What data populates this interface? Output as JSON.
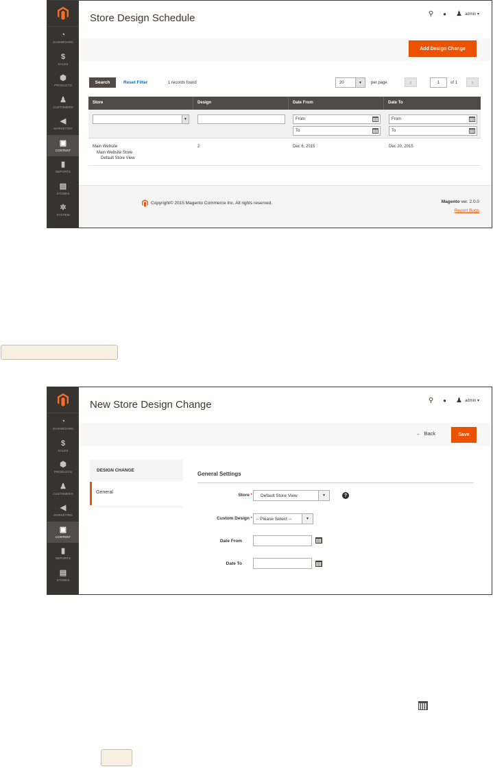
{
  "sidebar": {
    "items": [
      {
        "label": "DASHBOARD",
        "icon": "dashboard-icon",
        "glyph": "◔"
      },
      {
        "label": "SALES",
        "icon": "dollar-icon",
        "glyph": "$"
      },
      {
        "label": "PRODUCTS",
        "icon": "box-icon",
        "glyph": "⬢"
      },
      {
        "label": "CUSTOMERS",
        "icon": "person-icon",
        "glyph": "♟"
      },
      {
        "label": "MARKETING",
        "icon": "megaphone-icon",
        "glyph": "◀"
      },
      {
        "label": "CONTENT",
        "icon": "layout-icon",
        "glyph": "▣"
      },
      {
        "label": "REPORTS",
        "icon": "bar-chart-icon",
        "glyph": "▮"
      },
      {
        "label": "STORES",
        "icon": "store-icon",
        "glyph": "▤"
      },
      {
        "label": "SYSTEM",
        "icon": "gear-icon",
        "glyph": "✲"
      }
    ],
    "active_label": "CONTENT"
  },
  "header": {
    "admin_label": "admin ▾"
  },
  "schedule": {
    "title": "Store Design Schedule",
    "add_button": "Add Design Change",
    "search_button": "Search",
    "reset_filter": "Reset Filter",
    "records_found": "1 records found",
    "per_page_value": "20",
    "per_page_label": "per page",
    "page_current": "1",
    "page_of": "of 1",
    "columns": [
      "Store",
      "Design",
      "Date From",
      "Date To"
    ],
    "filter_from": "From",
    "filter_to": "To",
    "row": {
      "store_line1": "Main Website",
      "store_line2": "Main Website Store",
      "store_line3": "Default Store View",
      "design": "2",
      "date_from": "Dec 6, 2015",
      "date_to": "Dec 20, 2015"
    }
  },
  "footer": {
    "copyright": "Copyright© 2015 Magento Commerce Inc. All rights reserved.",
    "brand": "Magento",
    "version": " ver. 2.0.0",
    "report_bugs": "Report Bugs"
  },
  "new_change": {
    "title": "New Store Design Change",
    "back_button": "Back",
    "save_button": "Save",
    "tab_title": "DESIGN CHANGE",
    "tab_general": "General",
    "section_title": "General Settings",
    "store_label": "Store",
    "store_value": "Default Store View",
    "custom_design_label": "Custom Design",
    "custom_design_value": "-- Please Select --",
    "date_from_label": "Date From",
    "date_to_label": "Date To"
  },
  "colors": {
    "accent": "#eb5202",
    "sidebar": "#373330",
    "grid_header": "#514943",
    "callout": "#f8efe3"
  }
}
